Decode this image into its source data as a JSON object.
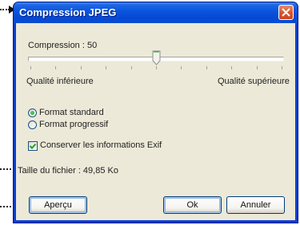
{
  "dialog": {
    "title": "Compression JPEG",
    "close_icon": "close-icon"
  },
  "compression": {
    "label": "Compression : 50",
    "value": 50,
    "min": 0,
    "max": 100,
    "low_label": "Qualité inférieure",
    "high_label": "Qualité supérieure"
  },
  "format": {
    "options": [
      {
        "label": "Format standard",
        "selected": true
      },
      {
        "label": "Format progressif",
        "selected": false
      }
    ]
  },
  "exif": {
    "label": "Conserver les informations Exif",
    "checked": true
  },
  "file_size": {
    "label": "Taille du fichier : 49,85 Ko"
  },
  "buttons": {
    "preview": "Aperçu",
    "ok": "Ok",
    "cancel": "Annuler"
  },
  "colors": {
    "title_bar": "#0a55df",
    "close": "#d9532d",
    "client": "#ece9d8",
    "button_border": "#003c74"
  }
}
